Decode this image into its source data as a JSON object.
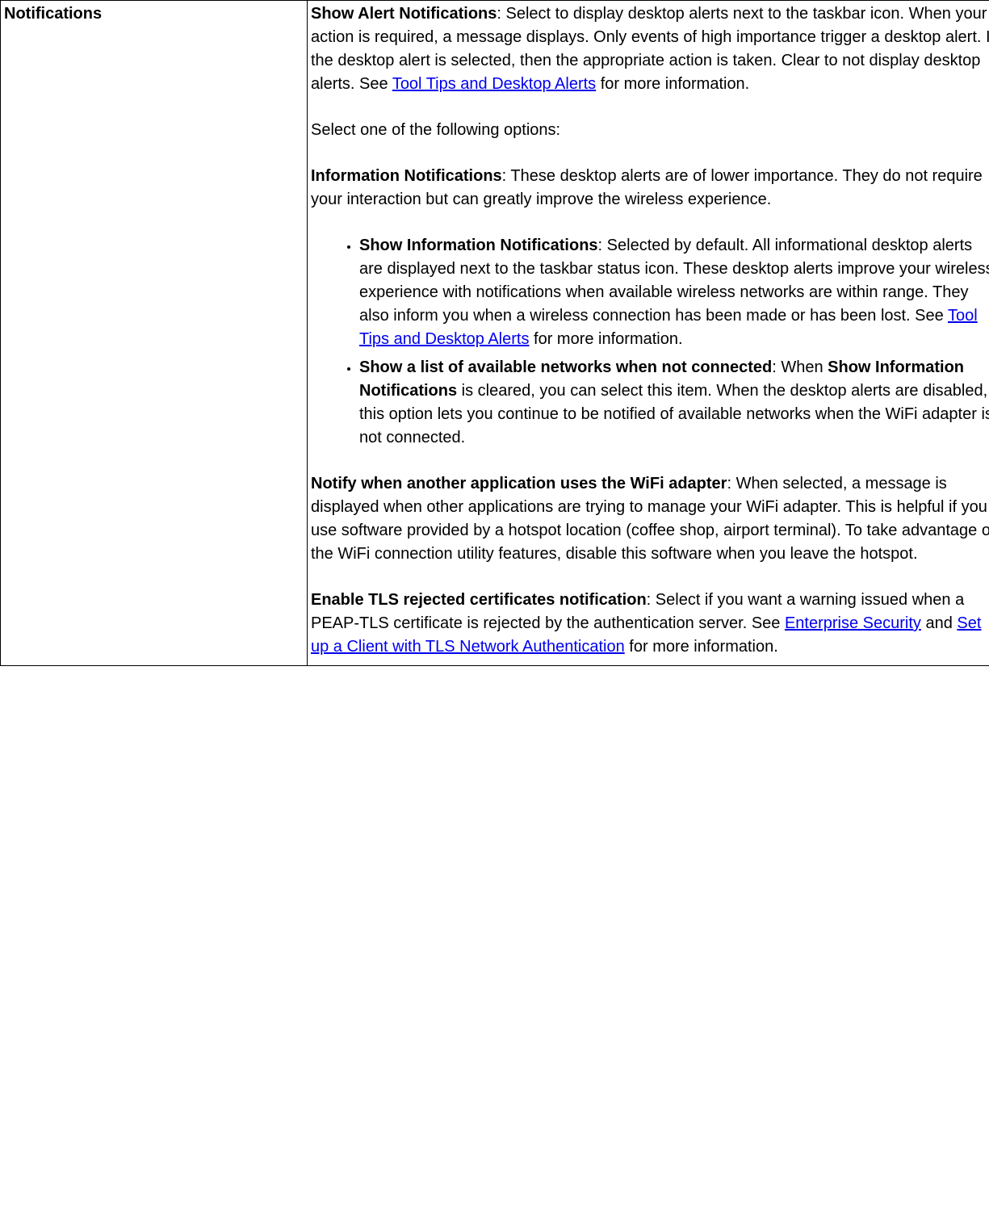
{
  "leftHeader": "Notifications",
  "p1_b": "Show Alert Notifications",
  "p1_a": ": Select to display desktop alerts next to the taskbar icon. When your action is required, a message displays. Only events of high importance trigger a desktop alert. If the desktop alert is selected, then the appropriate action is taken. Clear to not display desktop alerts. See ",
  "p1_link": "Tool Tips and Desktop Alerts",
  "p1_c": " for more information.",
  "p2": "Select one of the following options:",
  "p3_b": "Information Notifications",
  "p3_a": ": These desktop alerts are of lower importance. They do not require your interaction but can greatly improve the wireless experience.",
  "li1_b": "Show Information Notifications",
  "li1_a": ": Selected by default. All informational desktop alerts are displayed next to the taskbar status icon. These desktop alerts improve your wireless experience with notifications when available wireless networks are within range. They also inform you when a wireless connection has been made or has been lost. See ",
  "li1_link": "Tool Tips and Desktop Alerts",
  "li1_c": " for more information.",
  "li2_b": "Show a list of available networks when not connected",
  "li2_a": ": When ",
  "li2_b2": "Show Information Notifications",
  "li2_c": " is cleared, you can select this item. When the desktop alerts are disabled, this option lets you continue to be notified of available networks when the WiFi adapter is not connected.",
  "p4_b": "Notify when another application uses the WiFi adapter",
  "p4_a": ": When selected, a message is displayed when other applications are trying to manage your WiFi adapter. This is helpful if you use software provided by a hotspot location (coffee shop, airport terminal). To take advantage of the WiFi connection utility features, disable this software when you leave the hotspot.",
  "p5_b": "Enable TLS rejected certificates notification",
  "p5_a": ": Select if you want a warning issued when a PEAP-TLS certificate is rejected by the authentication server. See ",
  "p5_link1": "Enterprise Security",
  "p5_mid": " and ",
  "p5_link2": "Set up a Client with TLS Network Authentication",
  "p5_c": " for more information."
}
